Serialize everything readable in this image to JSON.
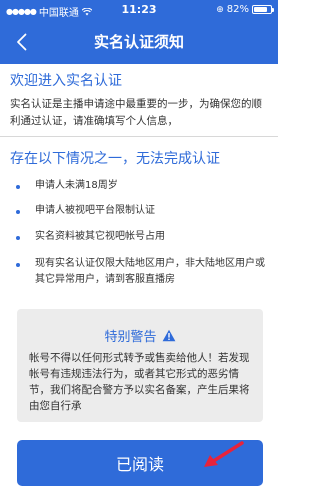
{
  "status_bar": {
    "carrier": "中国联通",
    "time": "11:23",
    "battery": "82%",
    "battery_level": 0.82
  },
  "nav": {
    "title": "实名认证须知"
  },
  "welcome": {
    "heading": "欢迎进入实名认证",
    "text": "实名认证是主播申请途中最重要的一步，为确保您的顺利通过认证，请准确填写个人信息，"
  },
  "conditions": {
    "heading": "存在以下情况之一，无法完成认证",
    "items": [
      "申请人未满18周岁",
      "申请人被视吧平台限制认证",
      "实名资料被其它视吧帐号占用",
      "现有实名认证仅限大陆地区用户，非大陆地区用户或其它异常用户，请到客服直播房"
    ]
  },
  "warning": {
    "title": "特别警告",
    "text": "帐号不得以任何形式转予或售卖给他人！若发现帐号有违规违法行为，或者其它形式的恶劣情节，我们将配合警方予以实名备案，产生后果将由您自行承"
  },
  "read_button": {
    "label": "已阅读"
  },
  "colors": {
    "accent": "#2f6bd9",
    "annotation_arrow": "#e8233a"
  }
}
